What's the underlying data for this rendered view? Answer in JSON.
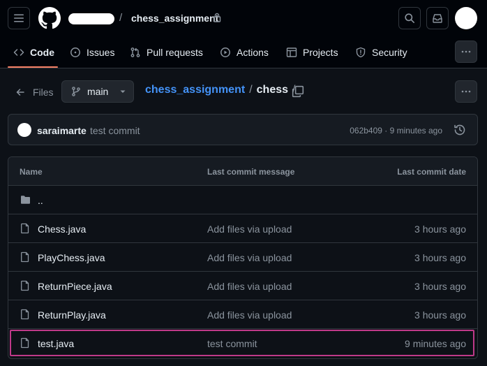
{
  "header": {
    "repo_name": "chess_assignment",
    "separator": "/",
    "icons": {
      "menu": "hamburger-icon",
      "logo": "github-logo",
      "lock": "lock-icon",
      "search": "search-icon",
      "inbox": "inbox-icon",
      "avatar": "avatar"
    }
  },
  "tabs": [
    {
      "label": "Code",
      "icon": "code-icon",
      "active": true
    },
    {
      "label": "Issues",
      "icon": "issue-icon",
      "active": false
    },
    {
      "label": "Pull requests",
      "icon": "pull-request-icon",
      "active": false
    },
    {
      "label": "Actions",
      "icon": "play-icon",
      "active": false
    },
    {
      "label": "Projects",
      "icon": "table-icon",
      "active": false
    },
    {
      "label": "Security",
      "icon": "shield-icon",
      "active": false
    }
  ],
  "path_bar": {
    "files_label": "Files",
    "branch": "main",
    "repo": "chess_assignment",
    "sep": "/",
    "dir": "chess",
    "trailing_sep": "/"
  },
  "latest_commit": {
    "author": "saraimarte",
    "message": "test commit",
    "meta": "062b409 · 9 minutes ago"
  },
  "table": {
    "headers": {
      "name": "Name",
      "message": "Last commit message",
      "date": "Last commit date"
    },
    "parent_dir": "..",
    "rows": [
      {
        "name": "Chess.java",
        "message": "Add files via upload",
        "date": "3 hours ago"
      },
      {
        "name": "PlayChess.java",
        "message": "Add files via upload",
        "date": "3 hours ago"
      },
      {
        "name": "ReturnPiece.java",
        "message": "Add files via upload",
        "date": "3 hours ago"
      },
      {
        "name": "ReturnPlay.java",
        "message": "Add files via upload",
        "date": "3 hours ago"
      },
      {
        "name": "test.java",
        "message": "test commit",
        "date": "9 minutes ago"
      }
    ]
  },
  "colors": {
    "accent_link": "#4493f8",
    "tab_underline": "#f78166",
    "highlight_border": "#bf3989"
  }
}
